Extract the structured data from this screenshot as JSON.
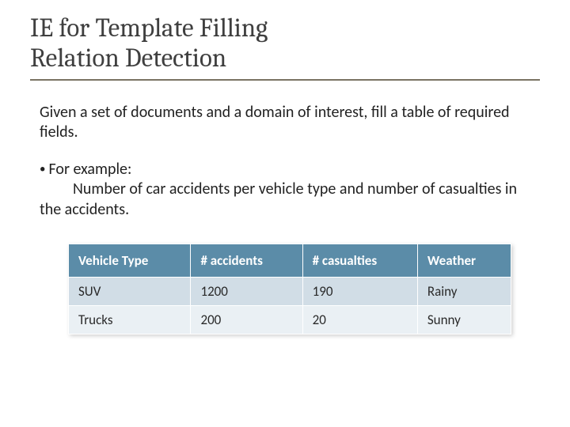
{
  "title_line1": "IE for Template Filling",
  "title_line2": "Relation Detection",
  "intro": "Given a set of documents and a domain of interest, fill a table of required fields.",
  "bullet_lead": "For example:",
  "bullet_detail": "Number of car accidents per vehicle type and number of casualties in the accidents.",
  "chart_data": {
    "type": "table",
    "columns": [
      "Vehicle Type",
      "# accidents",
      "# casualties",
      "Weather"
    ],
    "rows": [
      [
        "SUV",
        "1200",
        "190",
        "Rainy"
      ],
      [
        "Trucks",
        "200",
        "20",
        "Sunny"
      ]
    ]
  }
}
